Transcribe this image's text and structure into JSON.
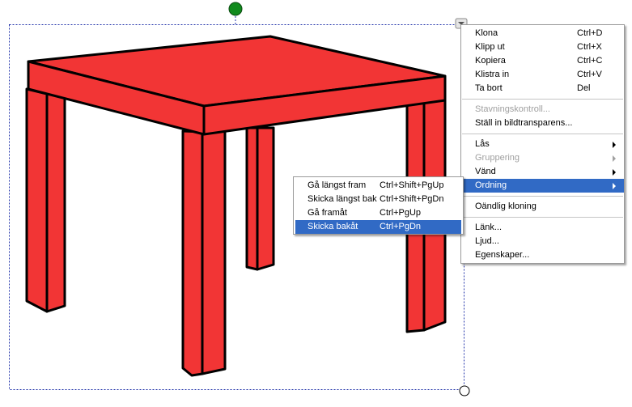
{
  "context_menu": {
    "clone": {
      "label": "Klona",
      "shortcut": "Ctrl+D"
    },
    "cut": {
      "label": "Klipp ut",
      "shortcut": "Ctrl+X"
    },
    "copy": {
      "label": "Kopiera",
      "shortcut": "Ctrl+C"
    },
    "paste": {
      "label": "Klistra in",
      "shortcut": "Ctrl+V"
    },
    "delete": {
      "label": "Ta bort",
      "shortcut": "Del"
    },
    "spellcheck": {
      "label": "Stavningskontroll..."
    },
    "transparency": {
      "label": "Ställ in bildtransparens..."
    },
    "lock": {
      "label": "Lås"
    },
    "grouping": {
      "label": "Gruppering"
    },
    "flip": {
      "label": "Vänd"
    },
    "order": {
      "label": "Ordning"
    },
    "infinite_clone": {
      "label": "Oändlig kloning"
    },
    "link": {
      "label": "Länk..."
    },
    "sound": {
      "label": "Ljud..."
    },
    "properties": {
      "label": "Egenskaper..."
    }
  },
  "order_submenu": {
    "bring_to_front": {
      "label": "Gå längst fram",
      "shortcut": "Ctrl+Shift+PgUp"
    },
    "send_to_back": {
      "label": "Skicka längst bak",
      "shortcut": "Ctrl+Shift+PgDn"
    },
    "bring_forward": {
      "label": "Gå framåt",
      "shortcut": "Ctrl+PgUp"
    },
    "send_backward": {
      "label": "Skicka bakåt",
      "shortcut": "Ctrl+PgDn"
    }
  },
  "colors": {
    "table_red": "#f23535",
    "rotation_handle": "#118a1d",
    "highlight": "#316ac5",
    "selection_border": "#2233aa"
  }
}
